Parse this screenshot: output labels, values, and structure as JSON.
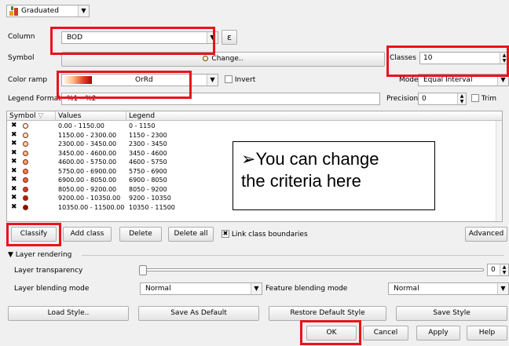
{
  "renderer": {
    "label": "Graduated",
    "icon": "graduated-renderer-icon"
  },
  "column": {
    "label": "Column",
    "value": "BOD",
    "expression_button": "ε"
  },
  "symbol": {
    "label": "Symbol",
    "change_button": "Change.."
  },
  "classes": {
    "label": "Classes",
    "value": "10"
  },
  "color_ramp": {
    "label": "Color ramp",
    "value": "OrRd",
    "invert_label": "Invert"
  },
  "mode": {
    "label": "Mode",
    "value": "Equal Interval"
  },
  "legend_format": {
    "label": "Legend Format",
    "value": "%1 - %2"
  },
  "precision": {
    "label": "Precision",
    "value": "0",
    "trim_label": "Trim"
  },
  "table": {
    "headers": [
      "Symbol",
      "Values",
      "Legend"
    ],
    "rows": [
      {
        "values": "0.00 - 1150.00",
        "legend": "0 - 1150",
        "color": "#fff3e3"
      },
      {
        "values": "1150.00 - 2300.00",
        "legend": "1150 - 2300",
        "color": "#fde4c4"
      },
      {
        "values": "2300.00 - 3450.00",
        "legend": "2300 - 3450",
        "color": "#fdd5a6"
      },
      {
        "values": "3450.00 - 4600.00",
        "legend": "3450 - 4600",
        "color": "#fcbf8a"
      },
      {
        "values": "4600.00 - 5750.00",
        "legend": "4600 - 5750",
        "color": "#fca06b"
      },
      {
        "values": "5750.00 - 6900.00",
        "legend": "5750 - 6900",
        "color": "#f6814f"
      },
      {
        "values": "6900.00 - 8050.00",
        "legend": "6900 - 8050",
        "color": "#ea5f3c"
      },
      {
        "values": "8050.00 - 9200.00",
        "legend": "8050 - 9200",
        "color": "#d93b26"
      },
      {
        "values": "9200.00 - 10350.00",
        "legend": "9200 - 10350",
        "color": "#bf1a10"
      },
      {
        "values": "10350.00 - 11500.00",
        "legend": "10350 - 11500",
        "color": "#9b0000"
      }
    ]
  },
  "callout": {
    "line1": "You can change",
    "line2": "the criteria here"
  },
  "buttons": {
    "classify": "Classify",
    "add_class": "Add class",
    "delete": "Delete",
    "delete_all": "Delete all",
    "link_label": "Link class boundaries",
    "advanced": "Advanced"
  },
  "layer_rendering": {
    "title": "Layer rendering",
    "transparency_label": "Layer transparency",
    "transparency_value": "0",
    "blending_label": "Layer blending mode",
    "blending_value": "Normal",
    "feature_blending_label": "Feature blending mode",
    "feature_blending_value": "Normal"
  },
  "style_buttons": {
    "load": "Load Style..",
    "save_default": "Save As Default",
    "restore_default": "Restore Default Style",
    "save": "Save Style"
  },
  "dialog_buttons": {
    "ok": "OK",
    "cancel": "Cancel",
    "apply": "Apply",
    "help": "Help"
  },
  "colors": {
    "highlight": "#e8141b",
    "ramp_start": "#fff7ec",
    "ramp_end": "#b30000"
  }
}
